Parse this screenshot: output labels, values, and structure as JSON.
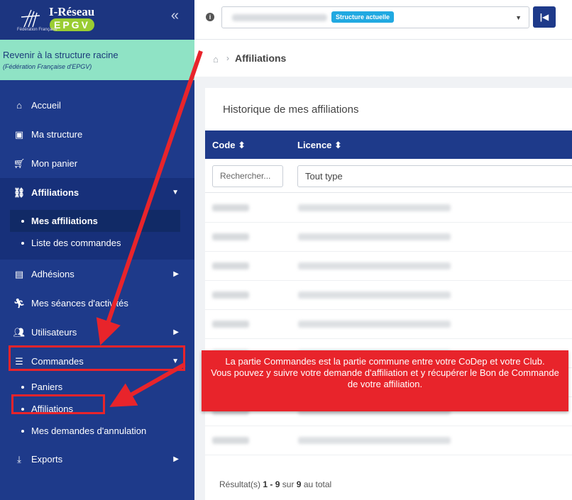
{
  "logo": {
    "title": "I-Réseau",
    "brand": "EPGV",
    "subtitle": "Fédération Française"
  },
  "sidebar": {
    "root": {
      "title": "Revenir à la structure racine",
      "subtitle": "(Fédération Française d'EPGV)"
    },
    "items": [
      {
        "label": "Accueil",
        "icon": "home-icon"
      },
      {
        "label": "Ma structure",
        "icon": "id-badge-icon"
      },
      {
        "label": "Mon panier",
        "icon": "cart-icon"
      },
      {
        "label": "Affiliations",
        "icon": "sitemap-icon",
        "children": [
          "Mes affiliations",
          "Liste des commandes"
        ]
      },
      {
        "label": "Adhésions",
        "icon": "id-card-icon"
      },
      {
        "label": "Mes séances d'activités",
        "icon": "running-icon"
      },
      {
        "label": "Utilisateurs",
        "icon": "users-icon"
      },
      {
        "label": "Commandes",
        "icon": "list-icon",
        "children": [
          "Paniers",
          "Affiliations",
          "Mes demandes d'annulation"
        ]
      },
      {
        "label": "Exports",
        "icon": "download-icon"
      }
    ]
  },
  "topbar": {
    "badge": "Structure actuelle"
  },
  "breadcrumb": {
    "current": "Affiliations"
  },
  "card": {
    "title": "Historique de mes affiliations",
    "columns": [
      "Code",
      "Licence"
    ],
    "search_placeholder": "Rechercher...",
    "type_filter": "Tout type",
    "result": {
      "prefix": "Résultat(s)",
      "from": "1",
      "sep": "-",
      "to": "9",
      "of": "sur",
      "total": "9",
      "suffix": "au total"
    }
  },
  "callout": {
    "text": "La partie Commandes est la partie commune entre votre CoDep et votre Club.\nVous pouvez y suivre votre demande d'affiliation et y récupérer le Bon de Commande de votre affiliation."
  },
  "colors": {
    "sidebar": "#1e3a8a",
    "accent_green": "#8fe3c5",
    "annotation_red": "#e8242b",
    "badge": "#21a9e1"
  }
}
